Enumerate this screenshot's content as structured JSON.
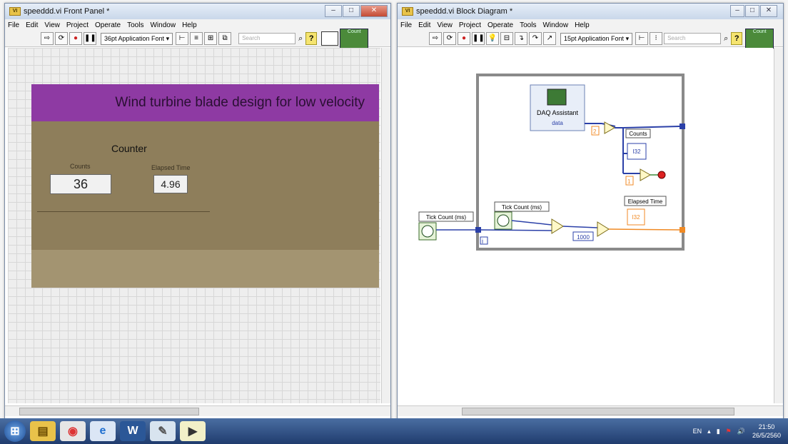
{
  "front_panel": {
    "title": "speeddd.vi Front Panel *",
    "menu": [
      "File",
      "Edit",
      "View",
      "Project",
      "Operate",
      "Tools",
      "Window",
      "Help"
    ],
    "font_select": "36pt Application Font",
    "search_placeholder": "Search",
    "context_help": "Count",
    "banner_title": "Wind turbine blade design for low velocity",
    "counter_heading": "Counter",
    "counts_label": "Counts",
    "counts_value": "36",
    "elapsed_label": "Elapsed Time",
    "elapsed_value": "4.96"
  },
  "block_diagram": {
    "title": "speeddd.vi Block Diagram *",
    "menu": [
      "File",
      "Edit",
      "View",
      "Project",
      "Operate",
      "Tools",
      "Window",
      "Help"
    ],
    "font_select": "15pt Application Font",
    "search_placeholder": "Search",
    "context_help": "Count",
    "daq_label": "DAQ Assistant",
    "daq_output": "data",
    "const_2": "2",
    "const_1": "1",
    "const_1000": "1000",
    "counts_indicator_label": "Counts",
    "counts_indicator_type": "I32",
    "elapsed_indicator_label": "Elapsed Time",
    "elapsed_indicator_type": "I32",
    "tick_count_outer": "Tick Count (ms)",
    "tick_count_inner": "Tick Count (ms)",
    "loop_iteration": "i"
  },
  "taskbar": {
    "lang": "EN",
    "time": "21:50",
    "date": "26/5/2560"
  },
  "colors": {
    "banner": "#8e3aa3",
    "panel": "#9d8d68",
    "wire_numeric": "#2b40a8",
    "wire_orange": "#f08a24",
    "taskbar": "#2a4a80"
  }
}
